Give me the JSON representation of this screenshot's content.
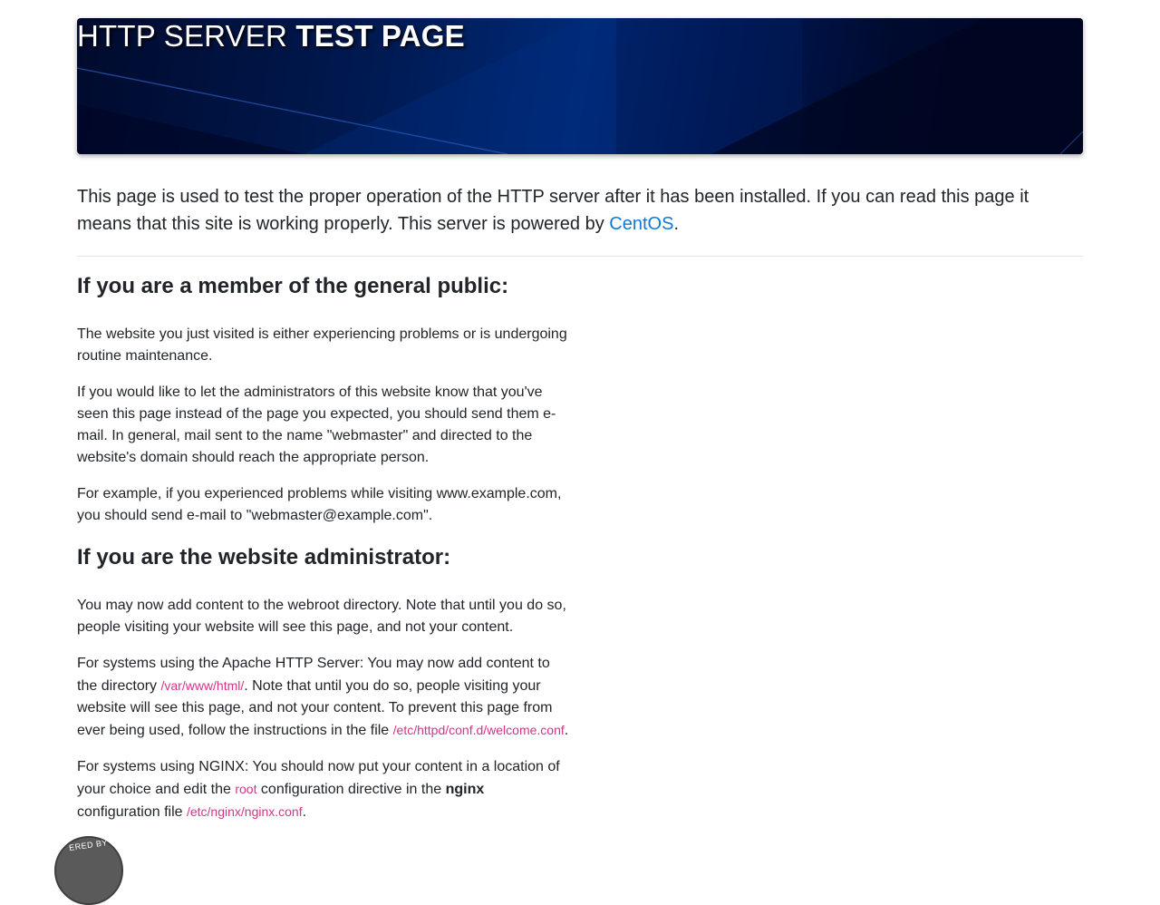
{
  "header": {
    "title_light": "HTTP SERVER",
    "title_bold": "TEST PAGE"
  },
  "lead": {
    "text": "This page is used to test the proper operation of the HTTP server after it has been installed. If you can read this page it means that this site is working properly. This server is powered by ",
    "link_label": "CentOS",
    "end": "."
  },
  "public_section": {
    "heading": "If you are a member of the general public:",
    "p1": "The website you just visited is either experiencing problems or is undergoing routine maintenance.",
    "p2": "If you would like to let the administrators of this website know that you've seen this page instead of the page you expected, you should send them e-mail. In general, mail sent to the name \"webmaster\" and directed to the website's domain should reach the appropriate person.",
    "p3": "For example, if you experienced problems while visiting www.example.com, you should send e-mail to \"webmaster@example.com\"."
  },
  "admin_section": {
    "heading": "If you are the website administrator:",
    "p1": "You may now add content to the webroot directory. Note that until you do so, people visiting your website will see this page, and not your content.",
    "apache_a": "For systems using the Apache HTTP Server: You may now add content to the directory ",
    "apache_path": "/var/www/html/",
    "apache_b": ". Note that until you do so, people visiting your website will see this page, and not your content. To prevent this page from ever being used, follow the instructions in the file ",
    "apache_conf": "/etc/httpd/conf.d/welcome.conf",
    "apache_end": ".",
    "nginx_a": "For systems using NGINX: You should now put your content in a location of your choice and edit the ",
    "nginx_root": "root",
    "nginx_b": " configuration directive in the ",
    "nginx_word": "nginx",
    "nginx_c": " configuration file ",
    "nginx_conf": "/etc/nginx/nginx.conf",
    "nginx_end": "."
  },
  "badge": {
    "text": "ERED BY"
  },
  "colors": {
    "link": "#0d7ad8",
    "code": "#d6338a",
    "banner_dark": "#000a2c",
    "banner_mid": "#012a78"
  }
}
